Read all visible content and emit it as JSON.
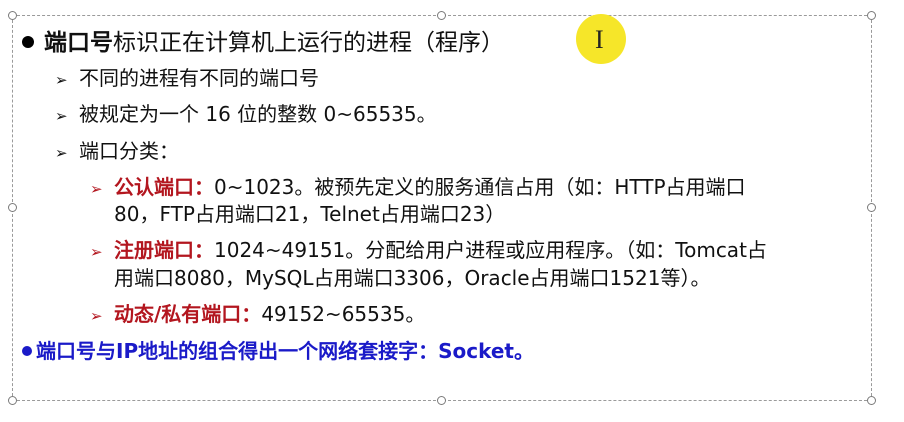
{
  "slide": {
    "title_bold": "端口号",
    "title_rest": "标识正在计算机上运行的进程（程序）",
    "bullets": [
      "不同的进程有不同的端口号",
      "被规定为一个 16 位的整数 0~65535。",
      "端口分类："
    ],
    "categories": [
      {
        "label": "公认端口：",
        "line1": "0~1023。被预先定义的服务通信占用（如：HTTP占用端口",
        "line2": "80，FTP占用端口21，Telnet占用端口23）"
      },
      {
        "label": "注册端口：",
        "line1": "1024~49151。分配给用户进程或应用程序。（如：Tomcat占",
        "line2": "用端口8080，MySQL占用端口3306，Oracle占用端口1521等）。"
      },
      {
        "label": "动态/私有端口：",
        "line1": "49152~65535。"
      }
    ],
    "footer": "端口号与IP地址的组合得出一个网络套接字：Socket。"
  },
  "cursor_icon": "i-beam-cursor",
  "colors": {
    "accent_red": "#b3161f",
    "accent_blue": "#1a1ac8",
    "highlight": "#f6e629"
  }
}
